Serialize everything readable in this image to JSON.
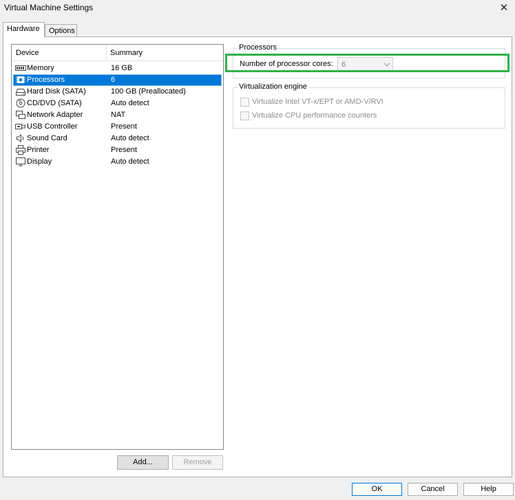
{
  "window": {
    "title": "Virtual Machine Settings",
    "close_glyph": "✕"
  },
  "tabs": [
    {
      "label": "Hardware",
      "active": true
    },
    {
      "label": "Options",
      "active": false
    }
  ],
  "device_list": {
    "columns": {
      "device": "Device",
      "summary": "Summary"
    },
    "rows": [
      {
        "device": "Memory",
        "summary": "16 GB",
        "icon": "memory-icon",
        "selected": false
      },
      {
        "device": "Processors",
        "summary": "6",
        "icon": "processor-icon",
        "selected": true
      },
      {
        "device": "Hard Disk (SATA)",
        "summary": "100 GB (Preallocated)",
        "icon": "hard-disk-icon",
        "selected": false
      },
      {
        "device": "CD/DVD (SATA)",
        "summary": "Auto detect",
        "icon": "cd-dvd-icon",
        "selected": false
      },
      {
        "device": "Network Adapter",
        "summary": "NAT",
        "icon": "network-adapter-icon",
        "selected": false
      },
      {
        "device": "USB Controller",
        "summary": "Present",
        "icon": "usb-icon",
        "selected": false
      },
      {
        "device": "Sound Card",
        "summary": "Auto detect",
        "icon": "speaker-icon",
        "selected": false
      },
      {
        "device": "Printer",
        "summary": "Present",
        "icon": "printer-icon",
        "selected": false
      },
      {
        "device": "Display",
        "summary": "Auto detect",
        "icon": "monitor-icon",
        "selected": false
      }
    ],
    "add_label": "Add...",
    "remove_label": "Remove"
  },
  "processors": {
    "group_title": "Processors",
    "cores_label": "Number of processor cores:",
    "cores_value": "6"
  },
  "virtualization": {
    "group_title": "Virtualization engine",
    "options": [
      {
        "label": "Virtualize Intel VT-x/EPT or AMD-V/RVI",
        "checked": false,
        "enabled": false
      },
      {
        "label": "Virtualize CPU performance counters",
        "checked": false,
        "enabled": false
      }
    ]
  },
  "footer": {
    "ok_label": "OK",
    "cancel_label": "Cancel",
    "help_label": "Help"
  },
  "colors": {
    "selection": "#0078d7",
    "highlight": "#2fb14a",
    "background": "#f0f0f0"
  }
}
